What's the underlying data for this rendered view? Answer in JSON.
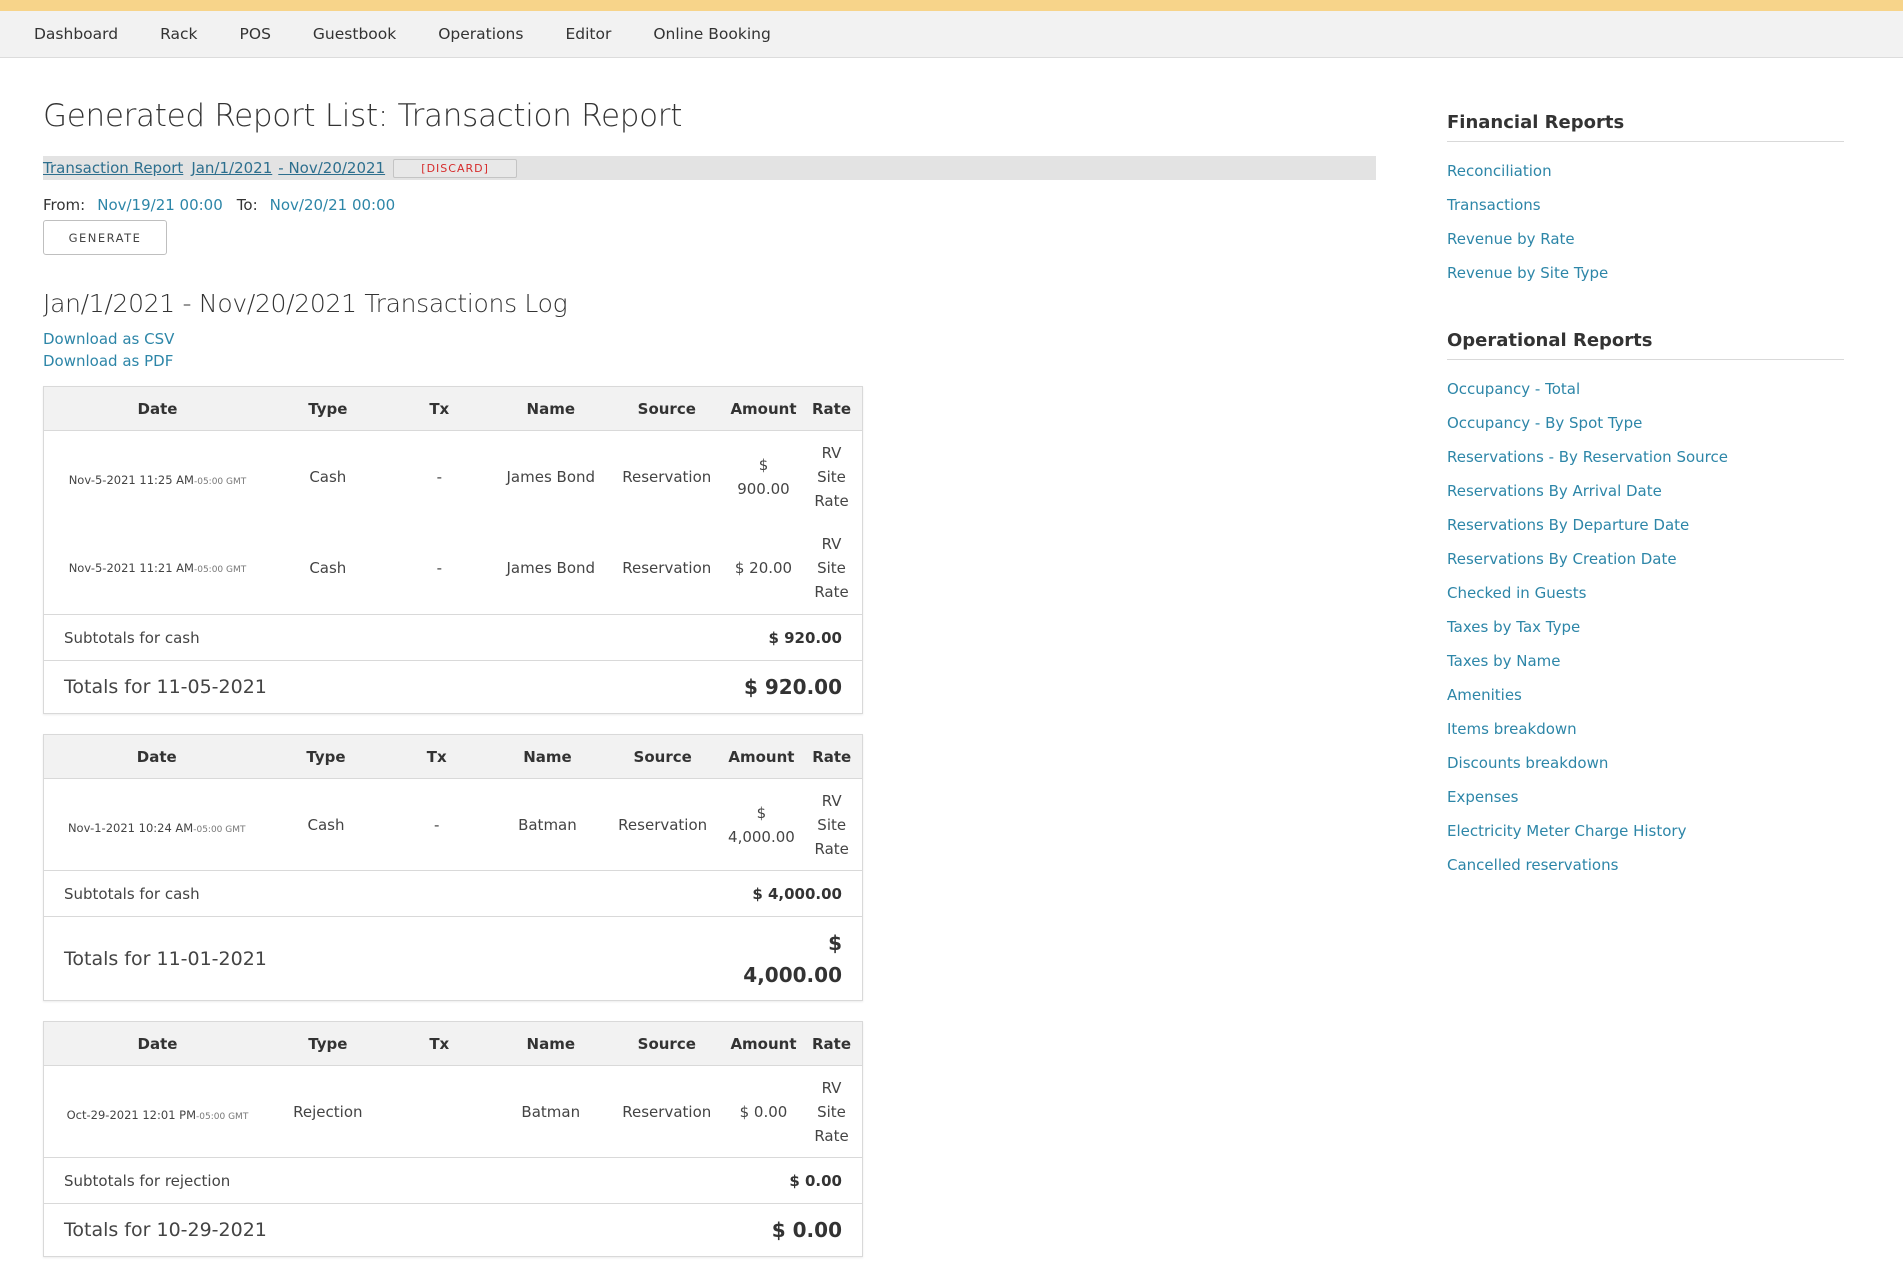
{
  "nav": [
    "Dashboard",
    "Rack",
    "POS",
    "Guestbook",
    "Operations",
    "Editor",
    "Online Booking"
  ],
  "page_title": "Generated Report List: Transaction Report",
  "report_bar": {
    "report_link": "Transaction Report",
    "start_link": "Jan/1/2021",
    "end_link": "- Nov/20/2021",
    "discard": "[DISCARD]"
  },
  "range": {
    "from_label": "From:",
    "from_value": "Nov/19/21 00:00",
    "to_label": "To:",
    "to_value": "Nov/20/21 00:00"
  },
  "generate_label": "GENERATE",
  "log_title": "Jan/1/2021 - Nov/20/2021 Transactions Log",
  "downloads": {
    "csv": "Download as CSV",
    "pdf": "Download as PDF"
  },
  "columns": [
    "Date",
    "Type",
    "Tx",
    "Name",
    "Source",
    "Amount",
    "Rate"
  ],
  "groups": [
    {
      "rows": [
        {
          "date": "Nov-5-2021 11:25 AM",
          "tz": "-05:00 GMT",
          "type": "Cash",
          "tx": "-",
          "name": "James Bond",
          "source": "Reservation",
          "amount_a": "$",
          "amount_b": "900.00",
          "rate": [
            "RV",
            "Site",
            "Rate"
          ]
        },
        {
          "date": "Nov-5-2021 11:21 AM",
          "tz": "-05:00 GMT",
          "type": "Cash",
          "tx": "-",
          "name": "James Bond",
          "source": "Reservation",
          "amount_a": "$ 20.00",
          "amount_b": "",
          "rate": [
            "RV",
            "Site",
            "Rate"
          ]
        }
      ],
      "subtotal_label": "Subtotals for cash",
      "subtotal_value": "$ 920.00",
      "total_label": "Totals for 11-05-2021",
      "total_value_a": "$ 920.00",
      "total_value_b": ""
    },
    {
      "rows": [
        {
          "date": "Nov-1-2021 10:24 AM",
          "tz": "-05:00 GMT",
          "type": "Cash",
          "tx": "-",
          "name": "Batman",
          "source": "Reservation",
          "amount_a": "$",
          "amount_b": "4,000.00",
          "rate": [
            "RV",
            "Site",
            "Rate"
          ]
        }
      ],
      "subtotal_label": "Subtotals for cash",
      "subtotal_value": "$ 4,000.00",
      "total_label": "Totals for 11-01-2021",
      "total_value_a": "$",
      "total_value_b": "4,000.00"
    },
    {
      "rows": [
        {
          "date": "Oct-29-2021 12:01 PM",
          "tz": "-05:00 GMT",
          "type": "Rejection",
          "tx": "",
          "name": "Batman",
          "source": "Reservation",
          "amount_a": "$ 0.00",
          "amount_b": "",
          "rate": [
            "RV",
            "Site",
            "Rate"
          ]
        }
      ],
      "subtotal_label": "Subtotals for rejection",
      "subtotal_value": "$ 0.00",
      "total_label": "Totals for 10-29-2021",
      "total_value_a": "$ 0.00",
      "total_value_b": ""
    }
  ],
  "sidebar": {
    "financial_title": "Financial Reports",
    "financial": [
      "Reconciliation",
      "Transactions",
      "Revenue by Rate",
      "Revenue by Site Type"
    ],
    "operational_title": "Operational Reports",
    "operational": [
      "Occupancy - Total",
      "Occupancy - By Spot Type",
      "Reservations - By Reservation Source",
      "Reservations By Arrival Date",
      "Reservations By Departure Date",
      "Reservations By Creation Date",
      "Checked in Guests",
      "Taxes by Tax Type",
      "Taxes by Name",
      "Amenities",
      "Items breakdown",
      "Discounts breakdown",
      "Expenses",
      "Electricity Meter Charge History",
      "Cancelled reservations"
    ]
  },
  "colors": {
    "link": "#2d86a8",
    "accent_strip": "#f7d48a",
    "discard": "#d62b2b"
  }
}
